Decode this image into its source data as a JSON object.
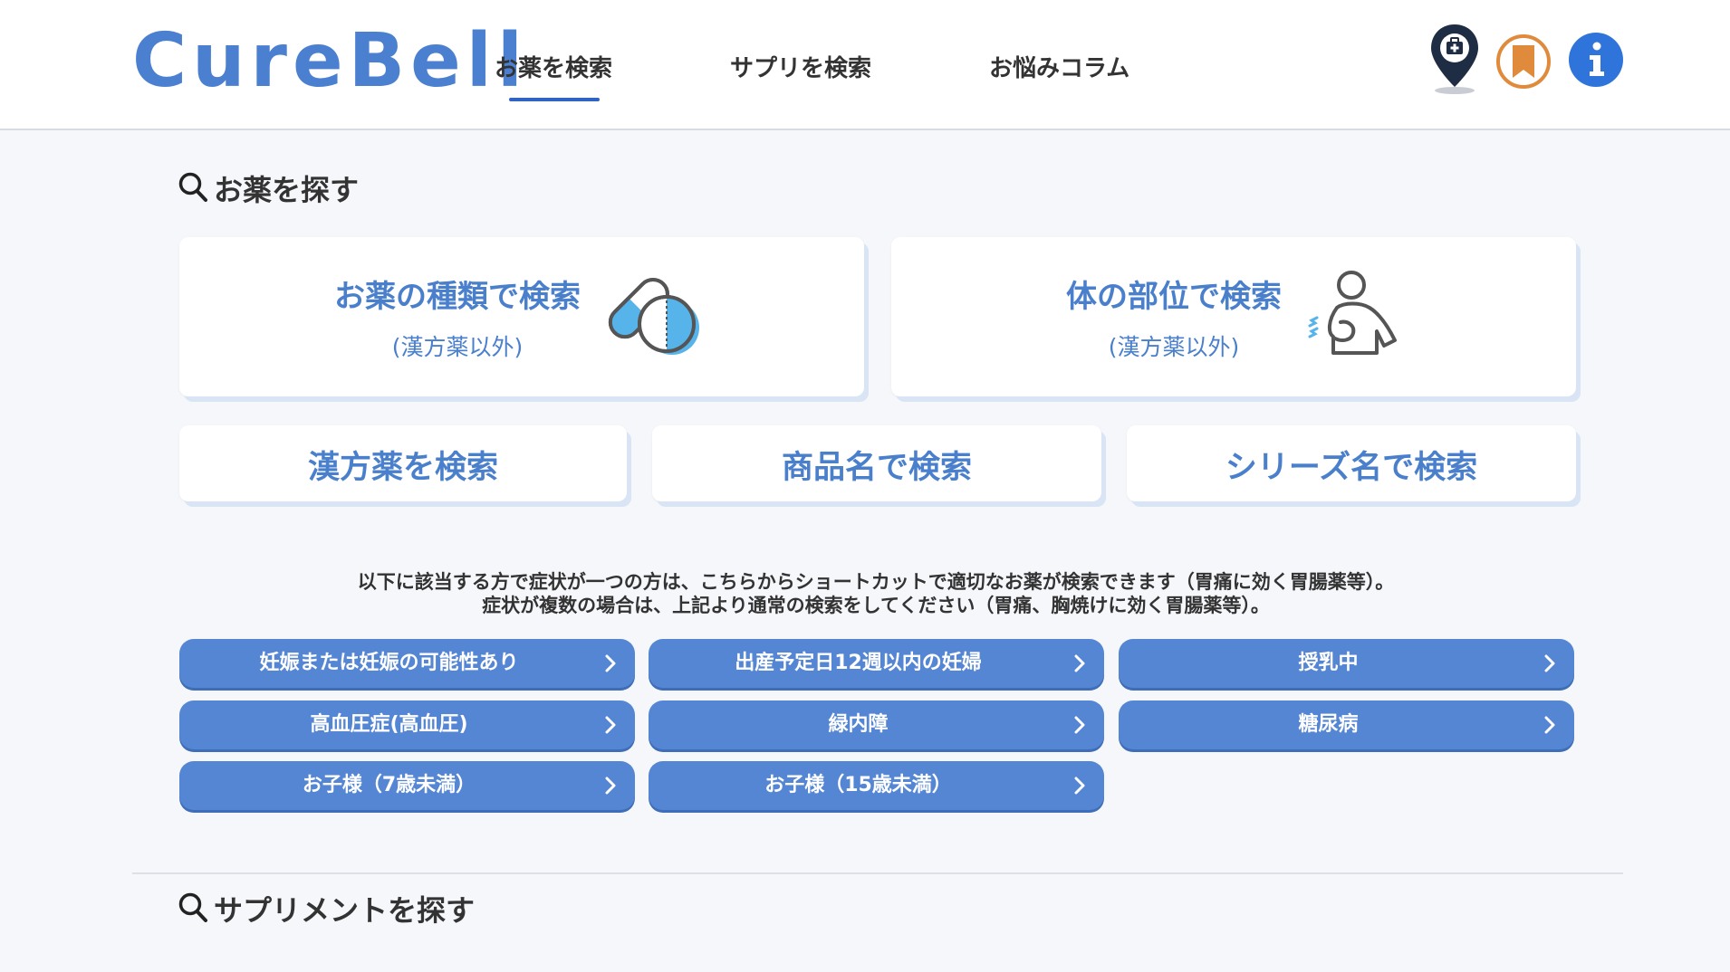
{
  "header": {
    "logo": "CureBell",
    "nav": [
      {
        "label": "お薬を検索",
        "active": true
      },
      {
        "label": "サプリを検索",
        "active": false
      },
      {
        "label": "お悩みコラム",
        "active": false
      }
    ],
    "icons": [
      "pharmacy-map-pin-icon",
      "bookmark-icon",
      "info-icon"
    ]
  },
  "medicine_section": {
    "title": "お薬を探す",
    "cards": [
      {
        "label": "お薬の種類で検索",
        "sub": "(漢方薬以外)",
        "icon": "capsule-tablet-icon"
      },
      {
        "label": "体の部位で検索",
        "sub": "(漢方薬以外)",
        "icon": "body-stomach-icon"
      }
    ],
    "small_cards": [
      {
        "label": "漢方薬を検索"
      },
      {
        "label": "商品名で検索"
      },
      {
        "label": "シリーズ名で検索"
      }
    ],
    "notice_line1": "以下に該当する方で症状が一つの方は、こちらからショートカットで適切なお薬が検索できます（胃痛に効く胃腸薬等）。",
    "notice_line2": "症状が複数の場合は、上記より通常の検索をしてください（胃痛、胸焼けに効く胃腸薬等）。",
    "shortcuts": [
      {
        "label": "妊娠または妊娠の可能性あり"
      },
      {
        "label": "出産予定日12週以内の妊婦"
      },
      {
        "label": "授乳中"
      },
      {
        "label": "高血圧症(高血圧)"
      },
      {
        "label": "緑内障"
      },
      {
        "label": "糖尿病"
      },
      {
        "label": "お子様（7歳未満）"
      },
      {
        "label": "お子様（15歳未満）"
      }
    ]
  },
  "supplement_section": {
    "title": "サプリメントを探す"
  },
  "colors": {
    "brand": "#4b80d1",
    "pill": "#5586d4",
    "bookmark": "#e08a3c",
    "info": "#2f74db"
  }
}
